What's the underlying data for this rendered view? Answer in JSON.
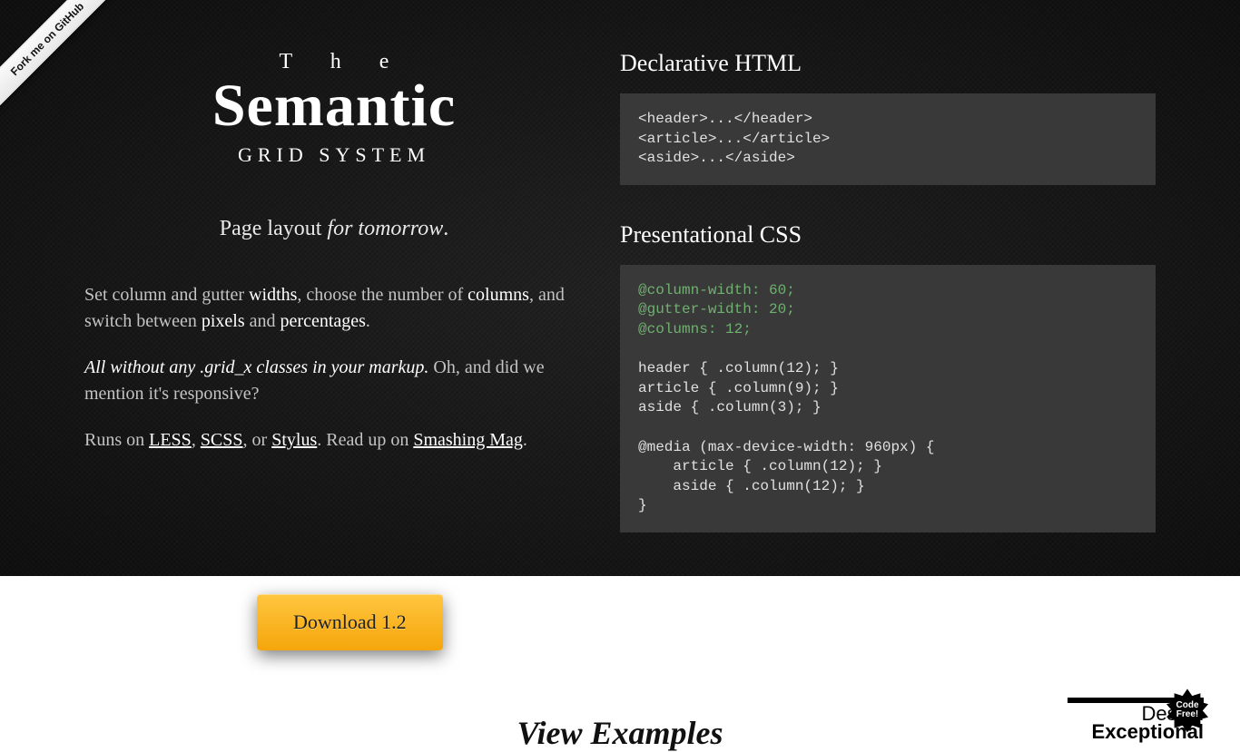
{
  "ribbon": "Fork me on GitHub",
  "title": {
    "the": "T h e",
    "main": "Semantic",
    "sub": "GRID SYSTEM"
  },
  "tagline": {
    "a": "Page layout ",
    "b": "for tomorrow",
    "c": "."
  },
  "para1": {
    "a": "Set column and gutter ",
    "b": "widths",
    "c": ", choose the number of ",
    "d": "columns",
    "e": ", and switch between ",
    "f": "pixels",
    "g": " and ",
    "h": "percentages",
    "i": "."
  },
  "para2": {
    "a": "All without any .grid_x classes in your markup.",
    "b": " Oh, and did we mention it's responsive?"
  },
  "para3": {
    "a": "Runs on ",
    "l1": "LESS",
    "b": ", ",
    "l2": "SCSS",
    "c": ", or ",
    "l3": "Stylus",
    "d": ". Read up on ",
    "l4": "Smashing Mag",
    "e": "."
  },
  "right": {
    "h1": "Declarative HTML",
    "code1": "<header>...</header>\n<article>...</article>\n<aside>...</aside>",
    "h2": "Presentational CSS",
    "code2a": "@column-width: 60;\n@gutter-width: 20;\n@columns: 12;",
    "code2b": "\n\nheader { .column(12); }\narticle { .column(9); }\naside { .column(3); }\n\n@media (max-device-width: 960px) {\n    article { .column(12); }\n    aside { .column(12); }\n}"
  },
  "download": "Download 1.2",
  "examples": "View Examples",
  "badge": {
    "burst": "Code\nFree!",
    "t1": "Design",
    "t2": "Exceptional"
  }
}
